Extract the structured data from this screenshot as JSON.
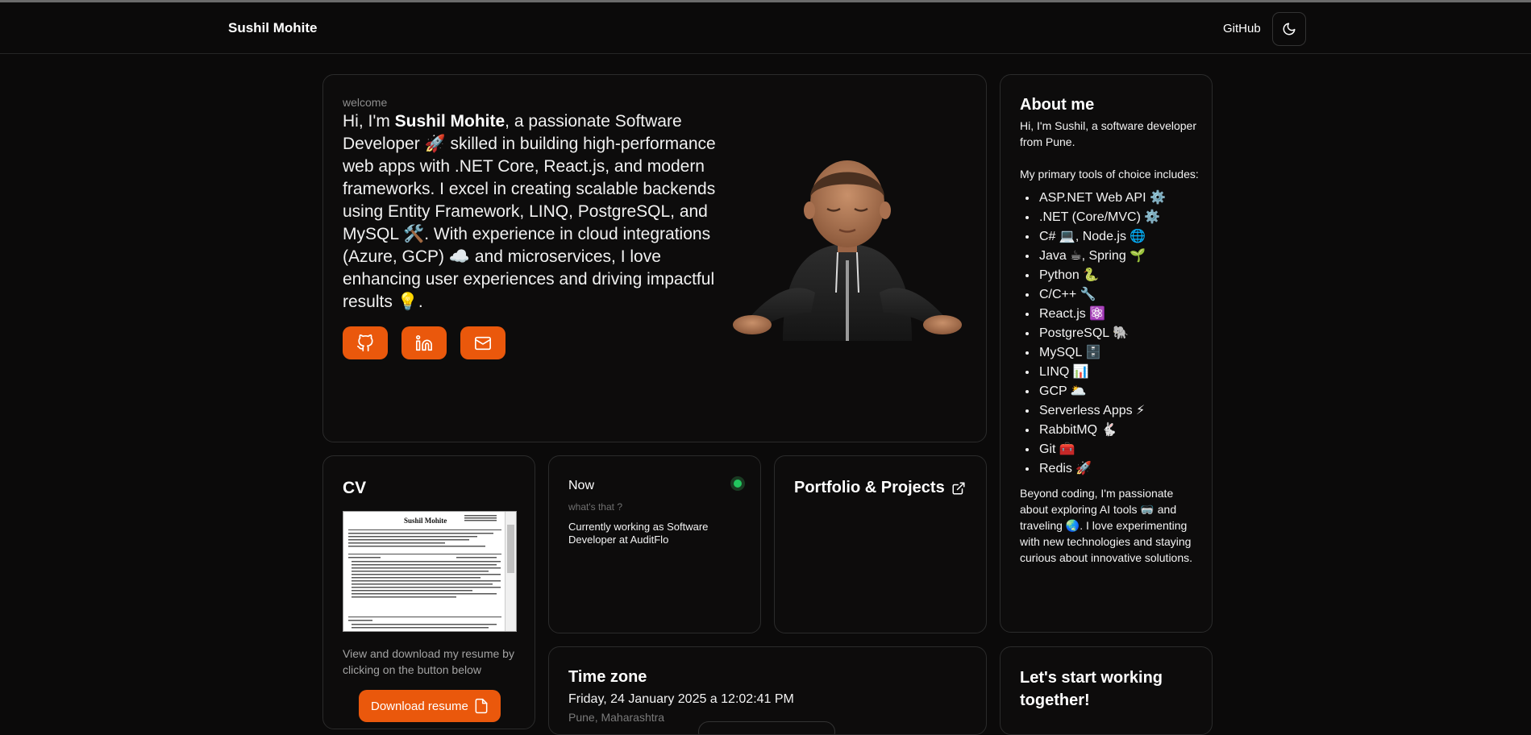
{
  "nav": {
    "brand": "Sushil Mohite",
    "github_label": "GitHub",
    "theme_icon": "moon-icon"
  },
  "hero": {
    "welcome": "welcome",
    "intro_pre": "Hi, I'm ",
    "intro_name": "Sushil Mohite",
    "intro_rest": ", a passionate Software Developer 🚀 skilled in building high-performance web apps with .NET Core, React.js, and modern frameworks. I excel in creating scalable backends using Entity Framework, LINQ, PostgreSQL, and MySQL 🛠️. With experience in cloud integrations (Azure, GCP) ☁️ and microservices, I love enhancing user experiences and driving impactful results 💡.",
    "social_icons": [
      "github-icon",
      "linkedin-icon",
      "mail-icon"
    ],
    "accent_color": "#ea580c"
  },
  "about": {
    "title": "About me",
    "intro": "Hi, I'm Sushil, a software developer from Pune.",
    "tools_heading": "My primary tools of choice includes:",
    "tools": [
      "ASP.NET Web API ⚙️",
      ".NET (Core/MVC) ⚙️",
      "C# 💻, Node.js 🌐",
      "Java ☕, Spring 🌱",
      "Python 🐍",
      "C/C++ 🔧",
      "React.js ⚛️",
      "PostgreSQL 🐘",
      "MySQL 🗄️",
      "LINQ 📊",
      "GCP 🌥️",
      "Serverless Apps ⚡",
      "RabbitMQ 🐇",
      "Git 🧰",
      "Redis 🚀"
    ],
    "outro": "Beyond coding, I'm passionate about exploring AI tools 🥽 and traveling 🌏. I love experimenting with new technologies and staying curious about innovative solutions."
  },
  "cv": {
    "title": "CV",
    "preview_name": "Sushil Mohite",
    "description": "View and download my resume by clicking on the button below",
    "download_label": "Download resume"
  },
  "now": {
    "title": "Now",
    "subtitle": "what's that ?",
    "text": "Currently working as Software Developer at AuditFlo",
    "status_color": "#22c55e"
  },
  "portfolio": {
    "title": "Portfolio & Projects"
  },
  "timezone": {
    "title": "Time zone",
    "datetime": "Friday, 24 January 2025 a 12:02:41 PM",
    "location": "Pune, Maharashtra"
  },
  "together": {
    "title": "Let's start working together!"
  }
}
